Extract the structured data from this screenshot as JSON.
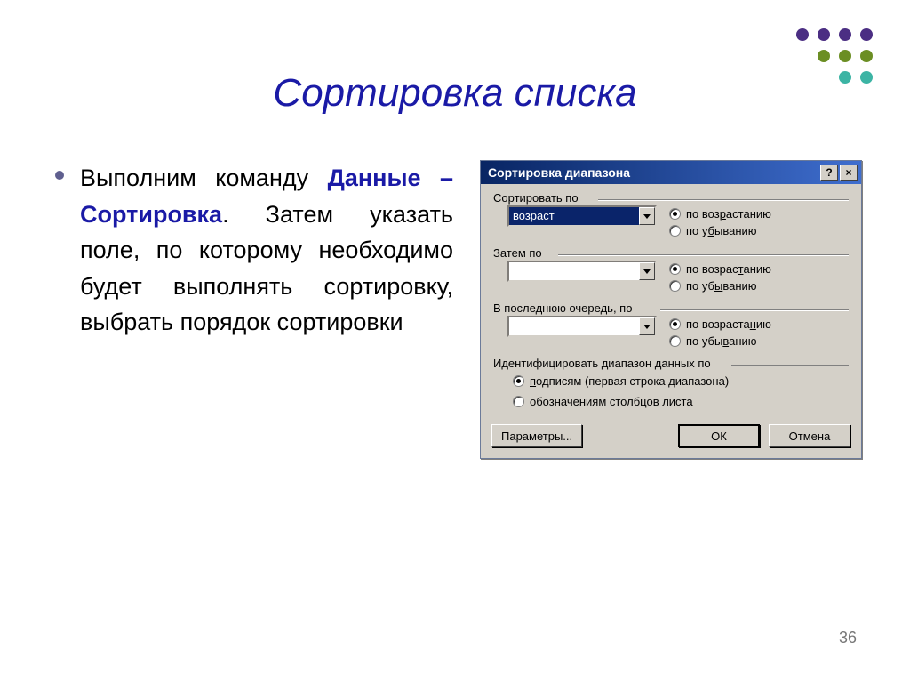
{
  "decor": {
    "dot_colors_row1": [
      "#4b2e83",
      "#4b2e83",
      "#4b2e83",
      "#4b2e83"
    ],
    "dot_colors_row2": [
      "#6b8e23",
      "#6b8e23",
      "#6b8e23"
    ],
    "dot_colors_row3": [
      "#3cb4a4",
      "#3cb4a4"
    ]
  },
  "slide": {
    "title": "Сортировка списка",
    "page_number": "36",
    "bullet_intro": " Выполним команду ",
    "bullet_cmd": "Данные – Сортировка",
    "bullet_rest": ". Затем указать поле, по которому необходимо будет выполнять сортировку, выбрать порядок сортировки"
  },
  "dialog": {
    "title": "Сортировка диапазона",
    "help_symbol": "?",
    "close_symbol": "×",
    "groups": {
      "sort_by": {
        "label": "Сортировать по",
        "combo_value": "возраст",
        "asc": "по возрастанию",
        "desc": "по убыванию"
      },
      "then_by": {
        "label": "Затем по",
        "combo_value": "",
        "asc": "по возрастанию",
        "desc": "по убыванию"
      },
      "last_by": {
        "label": "В последнюю очередь, по",
        "combo_value": "",
        "asc": "по возрастанию",
        "desc": "по убыванию"
      },
      "ident": {
        "label": "Идентифицировать диапазон данных по",
        "opt1": "подписям (первая строка диапазона)",
        "opt2": "обозначениям столбцов листа"
      }
    },
    "buttons": {
      "params": "Параметры...",
      "ok": "ОК",
      "cancel": "Отмена"
    }
  }
}
